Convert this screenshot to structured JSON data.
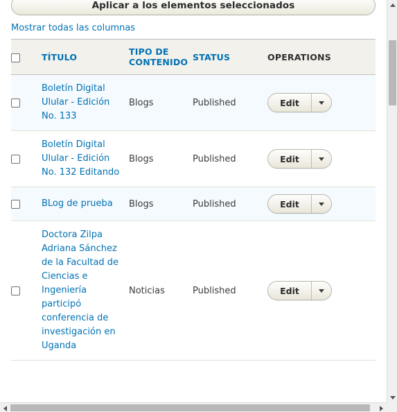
{
  "toolbar": {
    "apply_button_label": "Aplicar a los elementos seleccionados"
  },
  "links": {
    "show_all_columns": "Mostrar todas las columnas"
  },
  "table": {
    "columns": [
      {
        "key": "select",
        "label": "",
        "is_link": false
      },
      {
        "key": "title",
        "label": "TÍTULO",
        "is_link": true
      },
      {
        "key": "type",
        "label": "TIPO DE CONTENIDO",
        "is_link": true
      },
      {
        "key": "status",
        "label": "STATUS",
        "is_link": true
      },
      {
        "key": "ops",
        "label": "OPERATIONS",
        "is_link": false
      }
    ],
    "select_all_checked": false,
    "rows": [
      {
        "checked": false,
        "title": "Boletín Digital Ulular - Edición No. 133",
        "type": "Blogs",
        "status": "Published",
        "edit_label": "Edit"
      },
      {
        "checked": false,
        "title": "Boletín Digital Ulular - Edición No. 132 Editando",
        "type": "Blogs",
        "status": "Published",
        "edit_label": "Edit"
      },
      {
        "checked": false,
        "title": "BLog de prueba",
        "type": "Blogs",
        "status": "Published",
        "edit_label": "Edit"
      },
      {
        "checked": false,
        "title": "Doctora Zilpa Adriana Sánchez de la Facultad de Ciencias e Ingeniería participó conferencia de investigación en Uganda",
        "type": "Noticias",
        "status": "Published",
        "edit_label": "Edit"
      }
    ]
  },
  "colors": {
    "link_blue": "#0071b3",
    "header_bg": "#f2f1ec",
    "row_highlight": "#f4fafd",
    "text": "#3b3b3b",
    "button_border": "#b6b6b1",
    "scrollbar_thumb": "#b8b8b8"
  },
  "icons": {
    "dropdown_caret": "caret-down-icon",
    "scroll_up": "triangle-up-icon",
    "scroll_down": "triangle-down-icon",
    "scroll_left": "triangle-left-icon",
    "scroll_right": "triangle-right-icon"
  }
}
